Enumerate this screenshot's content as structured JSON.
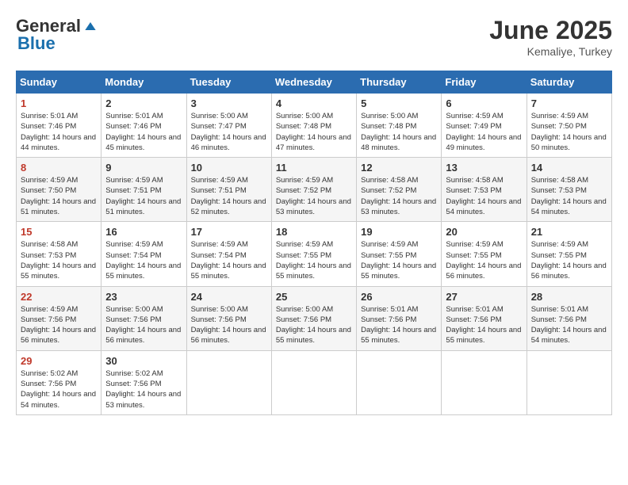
{
  "logo": {
    "general": "General",
    "blue": "Blue"
  },
  "title": {
    "month": "June 2025",
    "location": "Kemaliye, Turkey"
  },
  "headers": [
    "Sunday",
    "Monday",
    "Tuesday",
    "Wednesday",
    "Thursday",
    "Friday",
    "Saturday"
  ],
  "weeks": [
    [
      {
        "day": "1",
        "sunrise": "5:01 AM",
        "sunset": "7:46 PM",
        "daylight": "14 hours and 44 minutes."
      },
      {
        "day": "2",
        "sunrise": "5:01 AM",
        "sunset": "7:46 PM",
        "daylight": "14 hours and 45 minutes."
      },
      {
        "day": "3",
        "sunrise": "5:00 AM",
        "sunset": "7:47 PM",
        "daylight": "14 hours and 46 minutes."
      },
      {
        "day": "4",
        "sunrise": "5:00 AM",
        "sunset": "7:48 PM",
        "daylight": "14 hours and 47 minutes."
      },
      {
        "day": "5",
        "sunrise": "5:00 AM",
        "sunset": "7:48 PM",
        "daylight": "14 hours and 48 minutes."
      },
      {
        "day": "6",
        "sunrise": "4:59 AM",
        "sunset": "7:49 PM",
        "daylight": "14 hours and 49 minutes."
      },
      {
        "day": "7",
        "sunrise": "4:59 AM",
        "sunset": "7:50 PM",
        "daylight": "14 hours and 50 minutes."
      }
    ],
    [
      {
        "day": "8",
        "sunrise": "4:59 AM",
        "sunset": "7:50 PM",
        "daylight": "14 hours and 51 minutes."
      },
      {
        "day": "9",
        "sunrise": "4:59 AM",
        "sunset": "7:51 PM",
        "daylight": "14 hours and 51 minutes."
      },
      {
        "day": "10",
        "sunrise": "4:59 AM",
        "sunset": "7:51 PM",
        "daylight": "14 hours and 52 minutes."
      },
      {
        "day": "11",
        "sunrise": "4:59 AM",
        "sunset": "7:52 PM",
        "daylight": "14 hours and 53 minutes."
      },
      {
        "day": "12",
        "sunrise": "4:58 AM",
        "sunset": "7:52 PM",
        "daylight": "14 hours and 53 minutes."
      },
      {
        "day": "13",
        "sunrise": "4:58 AM",
        "sunset": "7:53 PM",
        "daylight": "14 hours and 54 minutes."
      },
      {
        "day": "14",
        "sunrise": "4:58 AM",
        "sunset": "7:53 PM",
        "daylight": "14 hours and 54 minutes."
      }
    ],
    [
      {
        "day": "15",
        "sunrise": "4:58 AM",
        "sunset": "7:53 PM",
        "daylight": "14 hours and 55 minutes."
      },
      {
        "day": "16",
        "sunrise": "4:59 AM",
        "sunset": "7:54 PM",
        "daylight": "14 hours and 55 minutes."
      },
      {
        "day": "17",
        "sunrise": "4:59 AM",
        "sunset": "7:54 PM",
        "daylight": "14 hours and 55 minutes."
      },
      {
        "day": "18",
        "sunrise": "4:59 AM",
        "sunset": "7:55 PM",
        "daylight": "14 hours and 55 minutes."
      },
      {
        "day": "19",
        "sunrise": "4:59 AM",
        "sunset": "7:55 PM",
        "daylight": "14 hours and 55 minutes."
      },
      {
        "day": "20",
        "sunrise": "4:59 AM",
        "sunset": "7:55 PM",
        "daylight": "14 hours and 56 minutes."
      },
      {
        "day": "21",
        "sunrise": "4:59 AM",
        "sunset": "7:55 PM",
        "daylight": "14 hours and 56 minutes."
      }
    ],
    [
      {
        "day": "22",
        "sunrise": "4:59 AM",
        "sunset": "7:56 PM",
        "daylight": "14 hours and 56 minutes."
      },
      {
        "day": "23",
        "sunrise": "5:00 AM",
        "sunset": "7:56 PM",
        "daylight": "14 hours and 56 minutes."
      },
      {
        "day": "24",
        "sunrise": "5:00 AM",
        "sunset": "7:56 PM",
        "daylight": "14 hours and 56 minutes."
      },
      {
        "day": "25",
        "sunrise": "5:00 AM",
        "sunset": "7:56 PM",
        "daylight": "14 hours and 55 minutes."
      },
      {
        "day": "26",
        "sunrise": "5:01 AM",
        "sunset": "7:56 PM",
        "daylight": "14 hours and 55 minutes."
      },
      {
        "day": "27",
        "sunrise": "5:01 AM",
        "sunset": "7:56 PM",
        "daylight": "14 hours and 55 minutes."
      },
      {
        "day": "28",
        "sunrise": "5:01 AM",
        "sunset": "7:56 PM",
        "daylight": "14 hours and 54 minutes."
      }
    ],
    [
      {
        "day": "29",
        "sunrise": "5:02 AM",
        "sunset": "7:56 PM",
        "daylight": "14 hours and 54 minutes."
      },
      {
        "day": "30",
        "sunrise": "5:02 AM",
        "sunset": "7:56 PM",
        "daylight": "14 hours and 53 minutes."
      },
      null,
      null,
      null,
      null,
      null
    ]
  ]
}
